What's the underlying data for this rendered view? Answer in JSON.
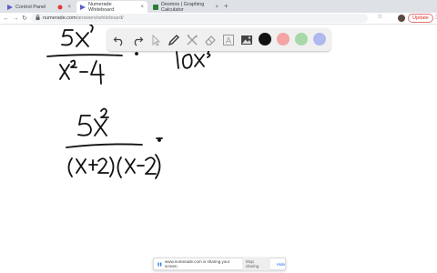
{
  "browser": {
    "tabs": [
      {
        "title": "Control Panel",
        "active": false
      },
      {
        "title": "Numerade Whiteboard",
        "active": true
      },
      {
        "title": "Desmos | Graphing Calculator",
        "active": false
      }
    ],
    "tab_close": "×",
    "new_tab": "+",
    "url_host": "numerade.com",
    "url_path": "/answers/whiteboard/",
    "back": "←",
    "forward": "→",
    "reload": "↻",
    "bookmark_star": "☆",
    "update_label": "Update",
    "menu": "⋮",
    "colors": {
      "accent_update": "#d93025",
      "tab_strip": "#dee1e6"
    }
  },
  "whiteboard": {
    "tools": [
      {
        "name": "undo",
        "icon": "undo-icon"
      },
      {
        "name": "redo",
        "icon": "redo-icon"
      },
      {
        "name": "select",
        "icon": "cursor-icon"
      },
      {
        "name": "pen",
        "icon": "pen-icon"
      },
      {
        "name": "tools",
        "icon": "wrench-icon"
      },
      {
        "name": "eraser",
        "icon": "eraser-icon"
      },
      {
        "name": "text",
        "icon": "text-icon"
      },
      {
        "name": "image",
        "icon": "image-icon"
      }
    ],
    "text_tool_glyph": "A",
    "colors": [
      "#111111",
      "#f4a4a4",
      "#a8d8a8",
      "#b0b8f0"
    ],
    "selected_color": "#111111"
  },
  "share_banner": {
    "message": "www.numerade.com is sharing your screen.",
    "stop_label": "Stop sharing",
    "hide_label": "Hide"
  }
}
